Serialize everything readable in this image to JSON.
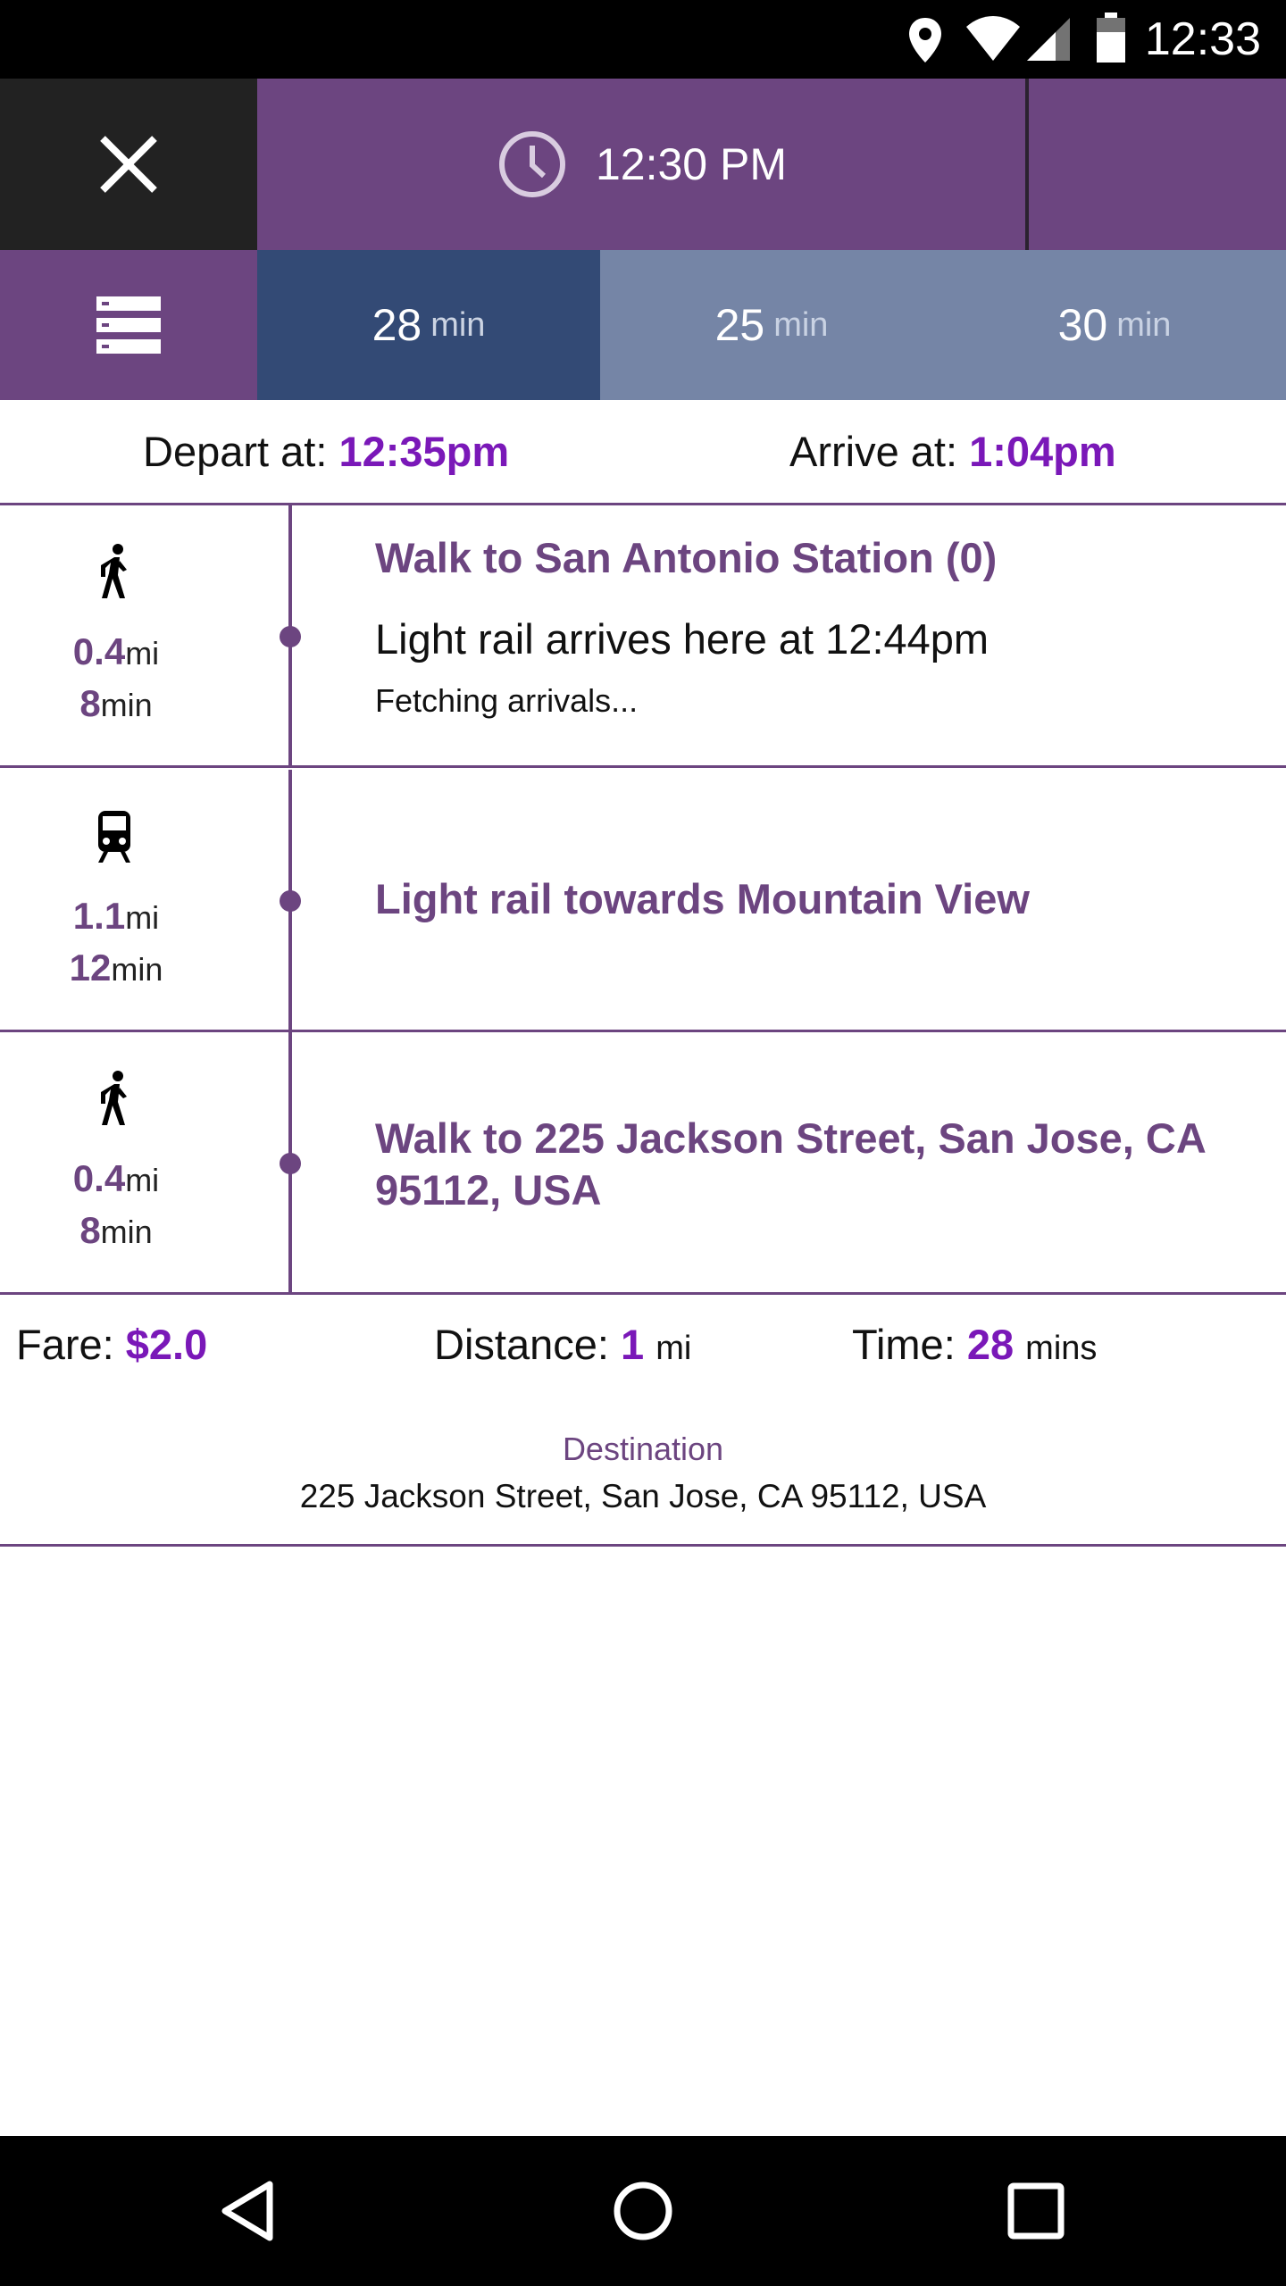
{
  "status_bar": {
    "time": "12:33",
    "icons": [
      "location-icon",
      "wifi-icon",
      "signal-icon",
      "battery-icon"
    ]
  },
  "header": {
    "close_icon": "close-icon",
    "clock_icon": "clock-icon",
    "selected_time": "12:30 PM",
    "list_icon": "list-icon"
  },
  "route_options": [
    {
      "value": "28",
      "unit": "min",
      "selected": true
    },
    {
      "value": "25",
      "unit": "min",
      "selected": false
    },
    {
      "value": "30",
      "unit": "min",
      "selected": false
    }
  ],
  "trip_times": {
    "depart_label": "Depart at:",
    "depart_value": "12:35pm",
    "arrive_label": "Arrive at:",
    "arrive_value": "1:04pm"
  },
  "legs": [
    {
      "mode_icon": "walk-icon",
      "distance": "0.4",
      "distance_unit": "mi",
      "duration": "8",
      "duration_unit": "min",
      "title": "Walk to San Antonio Station (0)",
      "subtitle": "Light rail arrives here at 12:44pm",
      "note": "Fetching arrivals..."
    },
    {
      "mode_icon": "train-icon",
      "distance": "1.1",
      "distance_unit": "mi",
      "duration": "12",
      "duration_unit": "min",
      "title": "Light rail towards Mountain View"
    },
    {
      "mode_icon": "walk-icon",
      "distance": "0.4",
      "distance_unit": "mi",
      "duration": "8",
      "duration_unit": "min",
      "title": "Walk to 225 Jackson Street, San Jose, CA 95112, USA"
    }
  ],
  "summary": {
    "fare_label": "Fare:",
    "fare_value": "$2.0",
    "distance_label": "Distance:",
    "distance_value": "1",
    "distance_unit": "mi",
    "time_label": "Time:",
    "time_value": "28",
    "time_unit": "mins"
  },
  "destination": {
    "label": "Destination",
    "address": "225 Jackson Street, San Jose, CA 95112, USA"
  },
  "nav_bar": {
    "icons": [
      "back-icon",
      "home-icon",
      "recents-icon"
    ]
  },
  "colors": {
    "purple": "#6c4580",
    "accent": "#7a18b8",
    "tab_active": "#334a75",
    "tab_inactive": "#7585a6",
    "close_bg": "#222222"
  }
}
